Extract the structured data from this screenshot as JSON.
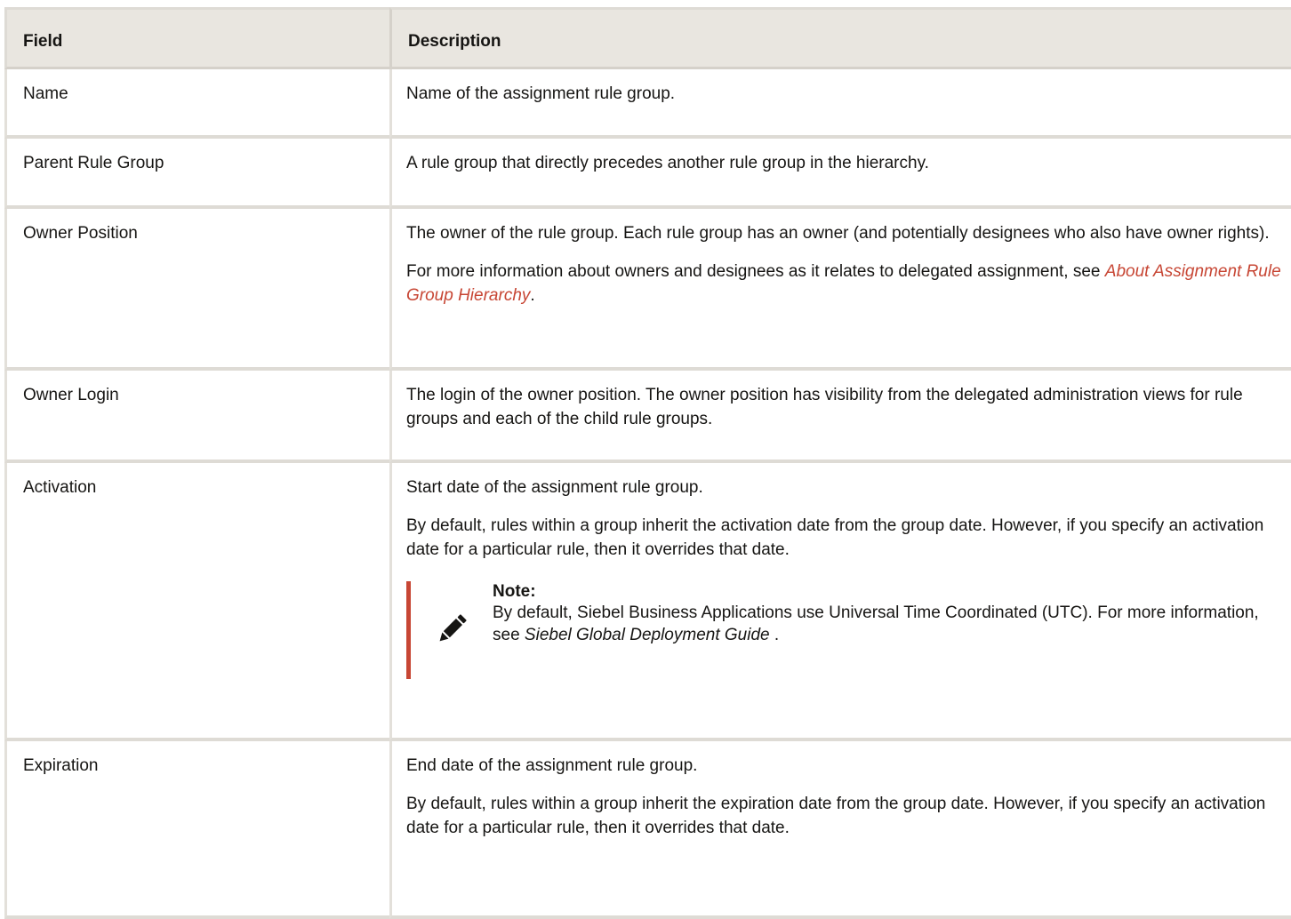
{
  "table": {
    "headers": [
      "Field",
      "Description"
    ],
    "rows": [
      {
        "field": "Name",
        "paragraphs": [
          "Name of the assignment rule group."
        ]
      },
      {
        "field": "Parent Rule Group",
        "paragraphs": [
          "A rule group that directly precedes another rule group in the hierarchy."
        ]
      },
      {
        "field": "Owner Position",
        "paragraphs": [
          "The owner of the rule group. Each rule group has an owner (and potentially designees who also have owner rights)."
        ],
        "link_paragraph": {
          "before": "For more information about owners and designees as it relates to delegated assignment, see ",
          "link": "About Assignment Rule Group Hierarchy",
          "after": "."
        }
      },
      {
        "field": "Owner Login",
        "paragraphs": [
          "The login of the owner position. The owner position has visibility from the delegated administration views for rule groups and each of the child rule groups."
        ]
      },
      {
        "field": "Activation",
        "paragraphs": [
          "Start date of the assignment rule group.",
          "By default, rules within a group inherit the activation date from the group date. However, if you specify an activation date for a particular rule, then it overrides that date."
        ],
        "note": {
          "title": "Note:",
          "text_before": "By default, Siebel Business Applications use Universal Time Coordinated (UTC). For more information, see ",
          "emphasis": "Siebel Global Deployment Guide",
          "text_after": " .",
          "icon": "pencil-icon"
        }
      },
      {
        "field": "Expiration",
        "paragraphs": [
          "End date of the assignment rule group.",
          "By default, rules within a group inherit the expiration date from the group date. However, if you specify an activation date for a particular rule, then it overrides that date."
        ]
      }
    ]
  },
  "colors": {
    "link": "#c74634",
    "header_bg": "#e9e6e0",
    "note_bar": "#c74634",
    "text": "#161513"
  }
}
